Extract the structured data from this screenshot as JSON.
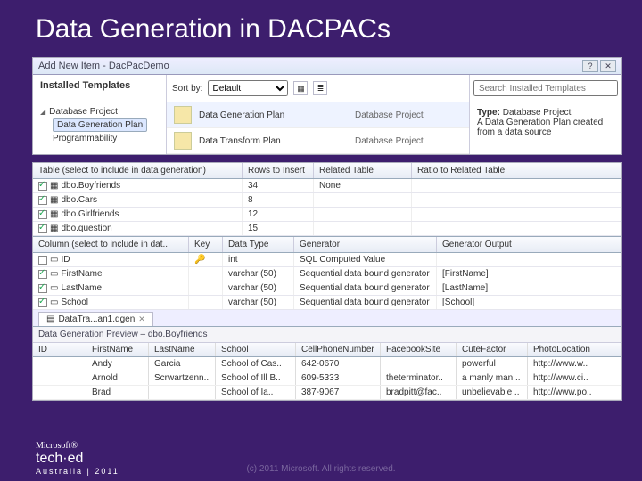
{
  "slide_title": "Data Generation in DACPACs",
  "dialog": {
    "title": "Add New Item - DacPacDemo",
    "help_btn": "?",
    "close_btn": "✕",
    "installed_header": "Installed Templates",
    "tree": {
      "root": "Database Project",
      "items": [
        "Data Generation Plan",
        "Programmability"
      ]
    },
    "sort_label": "Sort by:",
    "sort_value": "Default",
    "search_placeholder": "Search Installed Templates",
    "templates": [
      {
        "name": "Data Generation Plan",
        "cat": "Database Project"
      },
      {
        "name": "Data Transform Plan",
        "cat": "Database Project"
      }
    ],
    "desc_label": "Type:",
    "desc_type": "Database Project",
    "desc_text": "A Data Generation Plan created from a data source"
  },
  "tables_grid": {
    "headers": [
      "Table (select to include in data generation)",
      "Rows to Insert",
      "Related Table",
      "Ratio to Related Table"
    ],
    "rows": [
      {
        "on": true,
        "name": "dbo.Boyfriends",
        "rows": "34",
        "rel": "None",
        "ratio": ""
      },
      {
        "on": true,
        "name": "dbo.Cars",
        "rows": "8",
        "rel": "",
        "ratio": ""
      },
      {
        "on": true,
        "name": "dbo.Girlfriends",
        "rows": "12",
        "rel": "",
        "ratio": ""
      },
      {
        "on": true,
        "name": "dbo.question",
        "rows": "15",
        "rel": "",
        "ratio": ""
      }
    ]
  },
  "columns_grid": {
    "headers": [
      "Column (select to include in dat..",
      "Key",
      "Data Type",
      "Generator",
      "Generator Output"
    ],
    "rows": [
      {
        "on": false,
        "name": "ID",
        "key": true,
        "type": "int",
        "gen": "SQL Computed Value",
        "out": ""
      },
      {
        "on": true,
        "name": "FirstName",
        "key": false,
        "type": "varchar (50)",
        "gen": "Sequential data bound generator",
        "out": "[FirstName]"
      },
      {
        "on": true,
        "name": "LastName",
        "key": false,
        "type": "varchar (50)",
        "gen": "Sequential data bound generator",
        "out": "[LastName]"
      },
      {
        "on": true,
        "name": "School",
        "key": false,
        "type": "varchar (50)",
        "gen": "Sequential data bound generator",
        "out": "[School]"
      }
    ]
  },
  "preview": {
    "tab": "DataTra...an1.dgen",
    "section": "Data Generation Preview – dbo.Boyfriends",
    "headers": [
      "ID",
      "FirstName",
      "LastName",
      "School",
      "CellPhoneNumber",
      "FacebookSite",
      "CuteFactor",
      "PhotoLocation"
    ],
    "rows": [
      [
        "",
        "Andy",
        "Garcia",
        "School of Cas..",
        "642-0670",
        "",
        "powerful",
        "http://www.w.."
      ],
      [
        "",
        "Arnold",
        "Scrwartzenn..",
        "School of Ill B..",
        "609-5333",
        "theterminator..",
        "a manly man ..",
        "http://www.ci.."
      ],
      [
        "",
        "Brad",
        "",
        "School of Ia..",
        "387-9067",
        "bradpitt@fac..",
        "unbelievable ..",
        "http://www.po.."
      ]
    ]
  },
  "copyright": "(c) 2011 Microsoft. All rights reserved.",
  "year": "2011",
  "aus": "Australia"
}
